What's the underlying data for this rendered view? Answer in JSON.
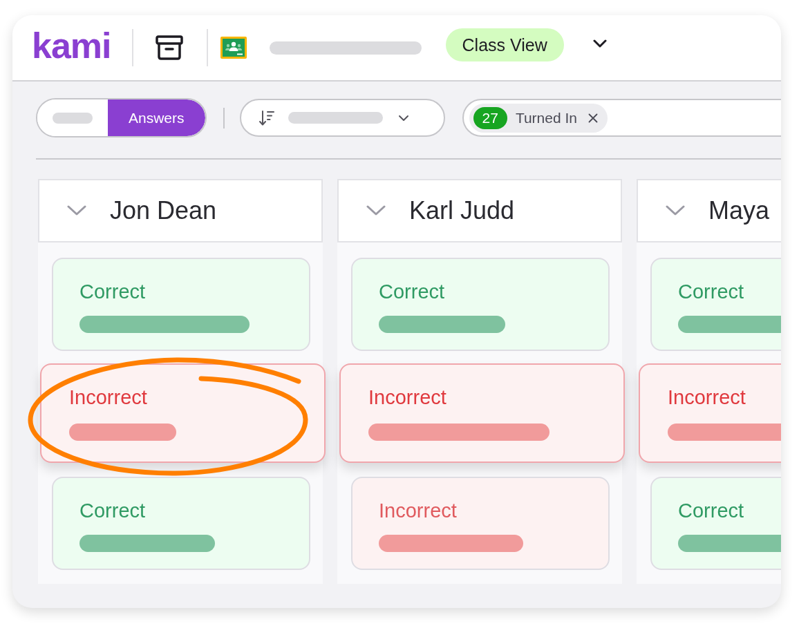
{
  "header": {
    "logo": "kami",
    "view_button": "Class View"
  },
  "toolbar": {
    "view_toggle": [
      {
        "selected": false
      },
      {
        "label": "Answers",
        "selected": true
      }
    ],
    "filters": [
      {
        "count": "27",
        "label": "Turned In"
      }
    ]
  },
  "columns": [
    {
      "name": "Jon Dean",
      "cards": [
        {
          "kind": "correct",
          "label": "Correct",
          "selected": false,
          "circled": false
        },
        {
          "kind": "incorrect",
          "label": "Incorrect",
          "selected": true,
          "circled": true
        },
        {
          "kind": "correct",
          "label": "Correct",
          "selected": false,
          "circled": false
        }
      ]
    },
    {
      "name": "Karl Judd",
      "cards": [
        {
          "kind": "correct",
          "label": "Correct",
          "selected": false,
          "circled": false
        },
        {
          "kind": "incorrect",
          "label": "Incorrect",
          "selected": true,
          "circled": false
        },
        {
          "kind": "incorrect",
          "label": "Incorrect",
          "selected": false,
          "circled": false
        }
      ]
    },
    {
      "name": "Maya",
      "cards": [
        {
          "kind": "correct",
          "label": "Correct",
          "selected": false,
          "circled": false
        },
        {
          "kind": "incorrect",
          "label": "Incorrect",
          "selected": true,
          "circled": false
        },
        {
          "kind": "correct",
          "label": "Correct",
          "selected": false,
          "circled": false
        }
      ]
    }
  ]
}
